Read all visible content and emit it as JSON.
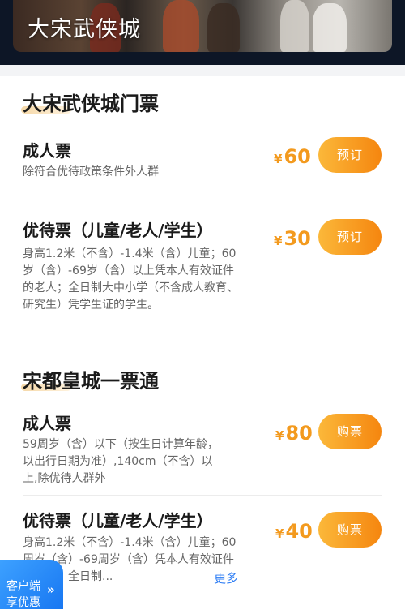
{
  "banner": {
    "title": "大宋武侠城"
  },
  "sections": [
    {
      "title": "大宋武侠城门票",
      "tickets": [
        {
          "name": "成人票",
          "desc": "除符合优待政策条件外人群",
          "currency": "¥",
          "price": "60",
          "button": "预订"
        },
        {
          "name": "优待票（儿童/老人/学生）",
          "desc": "身高1.2米（不含）-1.4米（含）儿童；60岁（含）-69岁（含）以上凭本人有效证件的老人；全日制大中小学（不含成人教育、研究生）凭学生证的学生。",
          "currency": "¥",
          "price": "30",
          "button": "预订"
        }
      ]
    },
    {
      "title": "宋都皇城一票通",
      "tickets": [
        {
          "name": "成人票",
          "desc": "59周岁（含）以下（按生日计算年龄，以出行日期为准）,140cm（不含）以上,除优待人群外",
          "currency": "¥",
          "price": "80",
          "button": "购票"
        },
        {
          "name": "优待票（儿童/老人/学生）",
          "desc": "身高1.2米（不含）-1.4米（含）儿童；60周岁（含）-69周岁（含）凭本人有效证件的老人；全日制...",
          "currency": "¥",
          "price": "40",
          "button": "购票",
          "more": "更多"
        }
      ]
    }
  ],
  "client_badge": {
    "line1": "客户端",
    "line2": "享优惠",
    "arrow": "»"
  }
}
